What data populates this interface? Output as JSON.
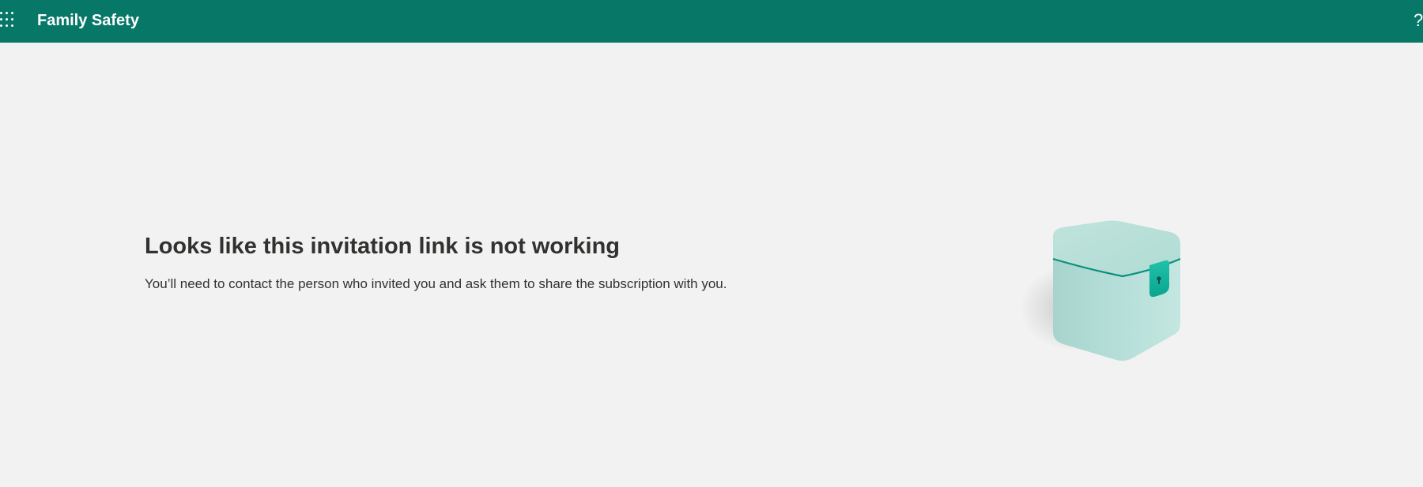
{
  "header": {
    "app_title": "Family Safety",
    "help_label": "?",
    "waffle_icon": "app-launcher-waffle-icon",
    "background_color": "#077868"
  },
  "main": {
    "headline": "Looks like this invitation link is not working",
    "message": "You’ll need to contact the person who invited you and ask them to share the subscription with you.",
    "illustration": "locked-box-illustration",
    "background_color": "#f2f2f2"
  }
}
